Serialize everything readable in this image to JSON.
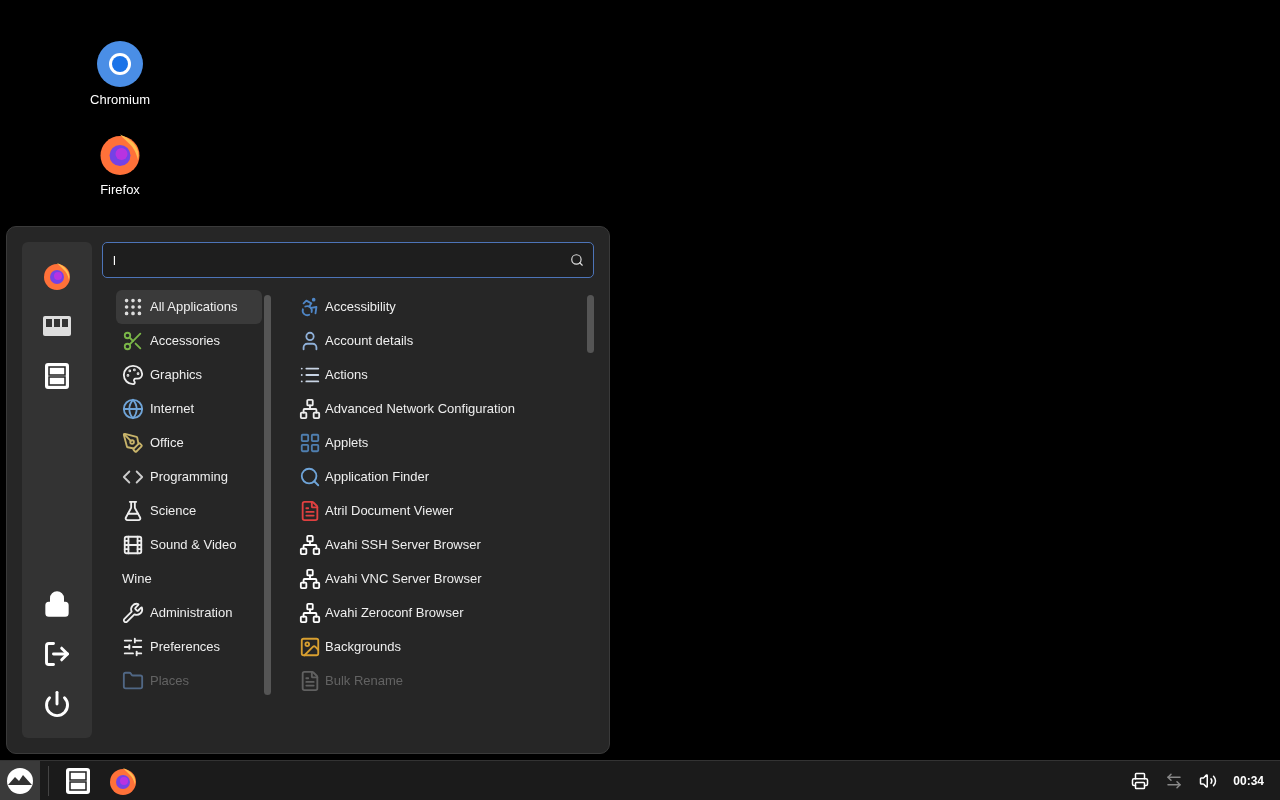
{
  "desktop_icons": [
    {
      "label": "Chromium",
      "kind": "chromium"
    },
    {
      "label": "Firefox",
      "kind": "firefox"
    }
  ],
  "menu": {
    "search": {
      "value": "l"
    },
    "categories": [
      {
        "label": "All Applications",
        "selected": true,
        "dimmed": false
      },
      {
        "label": "Accessories",
        "selected": false,
        "dimmed": false
      },
      {
        "label": "Graphics",
        "selected": false,
        "dimmed": false
      },
      {
        "label": "Internet",
        "selected": false,
        "dimmed": false
      },
      {
        "label": "Office",
        "selected": false,
        "dimmed": false
      },
      {
        "label": "Programming",
        "selected": false,
        "dimmed": false
      },
      {
        "label": "Science",
        "selected": false,
        "dimmed": false
      },
      {
        "label": "Sound & Video",
        "selected": false,
        "dimmed": false
      },
      {
        "label": "Wine",
        "selected": false,
        "dimmed": false
      },
      {
        "label": "Administration",
        "selected": false,
        "dimmed": false
      },
      {
        "label": "Preferences",
        "selected": false,
        "dimmed": false
      },
      {
        "label": "Places",
        "selected": false,
        "dimmed": true
      }
    ],
    "apps": [
      {
        "label": "Accessibility",
        "dimmed": false
      },
      {
        "label": "Account details",
        "dimmed": false
      },
      {
        "label": "Actions",
        "dimmed": false
      },
      {
        "label": "Advanced Network Configuration",
        "dimmed": false
      },
      {
        "label": "Applets",
        "dimmed": false
      },
      {
        "label": "Application Finder",
        "dimmed": false
      },
      {
        "label": "Atril Document Viewer",
        "dimmed": false
      },
      {
        "label": "Avahi SSH Server Browser",
        "dimmed": false
      },
      {
        "label": "Avahi VNC Server Browser",
        "dimmed": false
      },
      {
        "label": "Avahi Zeroconf Browser",
        "dimmed": false
      },
      {
        "label": "Backgrounds",
        "dimmed": false
      },
      {
        "label": "Bulk Rename",
        "dimmed": true
      }
    ]
  },
  "taskbar": {
    "clock": "00:34"
  }
}
